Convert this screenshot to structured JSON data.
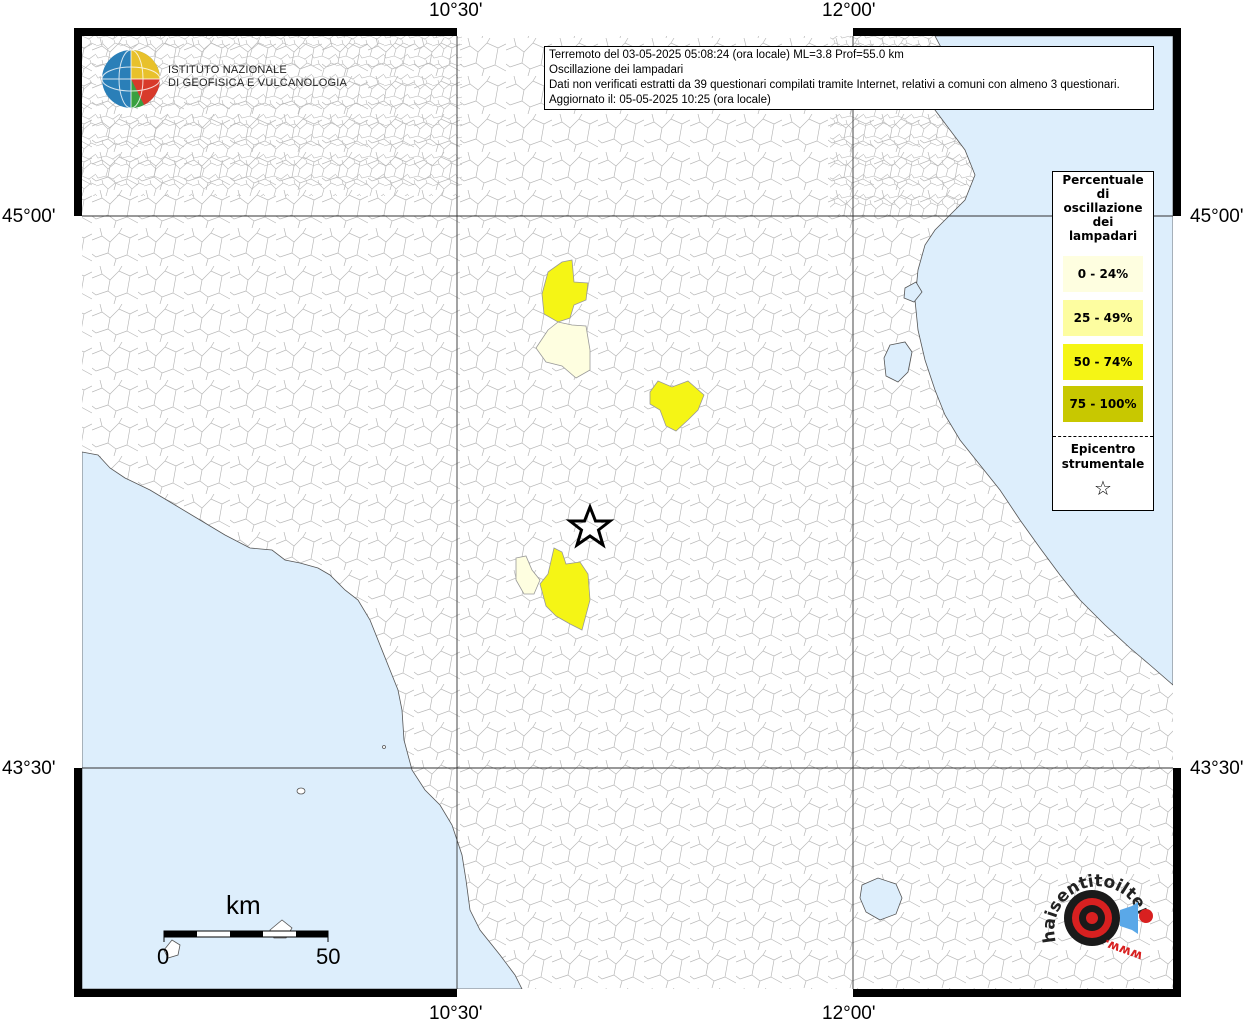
{
  "info": {
    "line1": "Terremoto del 03-05-2025 05:08:24 (ora locale) ML=3.8 Prof=55.0 km",
    "line2": "Oscillazione dei lampadari",
    "line3": "Dati non verificati estratti da 39 questionari compilati tramite Internet, relativi a comuni con almeno 3 questionari.",
    "line4": "Aggiornato il: 05-05-2025 10:25 (ora locale)"
  },
  "coords": {
    "top_left": "10°30'",
    "top_right": "12°00'",
    "bottom_left": "10°30'",
    "bottom_right": "12°00'",
    "left_upper": "45°00'",
    "left_lower": "43°30'",
    "right_upper": "45°00'",
    "right_lower": "43°30'"
  },
  "legend": {
    "title_lines": [
      "Percentuale",
      "di",
      "oscillazione",
      "dei",
      "lampadari"
    ],
    "classes": [
      {
        "label": "0 - 24%",
        "color": "#fefee0"
      },
      {
        "label": "25 - 49%",
        "color": "#fdfda0"
      },
      {
        "label": "50 - 74%",
        "color": "#f5f515"
      },
      {
        "label": "75 - 100%",
        "color": "#c8c800"
      }
    ],
    "epicenter_lines": [
      "Epicentro",
      "strumentale"
    ],
    "star_symbol": "☆"
  },
  "scale": {
    "unit": "km",
    "min": "0",
    "max": "50"
  },
  "logos": {
    "ingv_line1": "ISTITUTO NAZIONALE",
    "ingv_line2": "DI GEOFISICA E VULCANOLOGIA",
    "hst_text": "haisentitoilterremoto.it",
    "hst_url": "www."
  },
  "colors": {
    "sea": "#ddeefc",
    "land": "#ffffff",
    "border": "#999999"
  }
}
